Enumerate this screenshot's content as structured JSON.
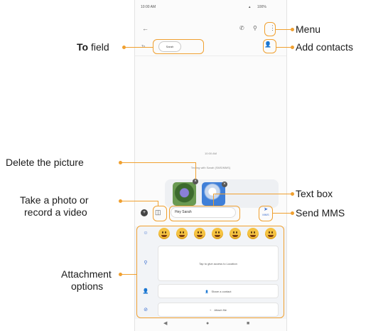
{
  "status": {
    "time": "10:00 AM",
    "signal": "4G",
    "battery": "100%"
  },
  "toolbar": {
    "back_icon": "arrow-left-icon",
    "call_icon": "phone-icon",
    "search_icon": "search-icon",
    "menu_icon": "more-vert-icon"
  },
  "to_field": {
    "prefix": "To",
    "recipient": "Sarah"
  },
  "thread": {
    "timestamp": "10:00 AM",
    "info": "Texting with Sarah (SMS/MMS)"
  },
  "composer": {
    "message": "Hey Sarah",
    "send_label": "MMS"
  },
  "attachments": {
    "location_text": "Tap to give access to Location",
    "share_contact": "Share a contact",
    "attach_file": "Attach file"
  },
  "callouts": {
    "menu": "Menu",
    "to_field_bold": "To",
    "to_field_rest": " field",
    "add_contacts": "Add contacts",
    "delete_picture": "Delete the picture",
    "take_photo_1": "Take a photo or",
    "take_photo_2": "record a video",
    "text_box": "Text box",
    "send_mms": "Send MMS",
    "attachment_1": "Attachment",
    "attachment_2": "options"
  },
  "colors": {
    "accent": "#f0a030",
    "primary": "#3b6fd1"
  }
}
